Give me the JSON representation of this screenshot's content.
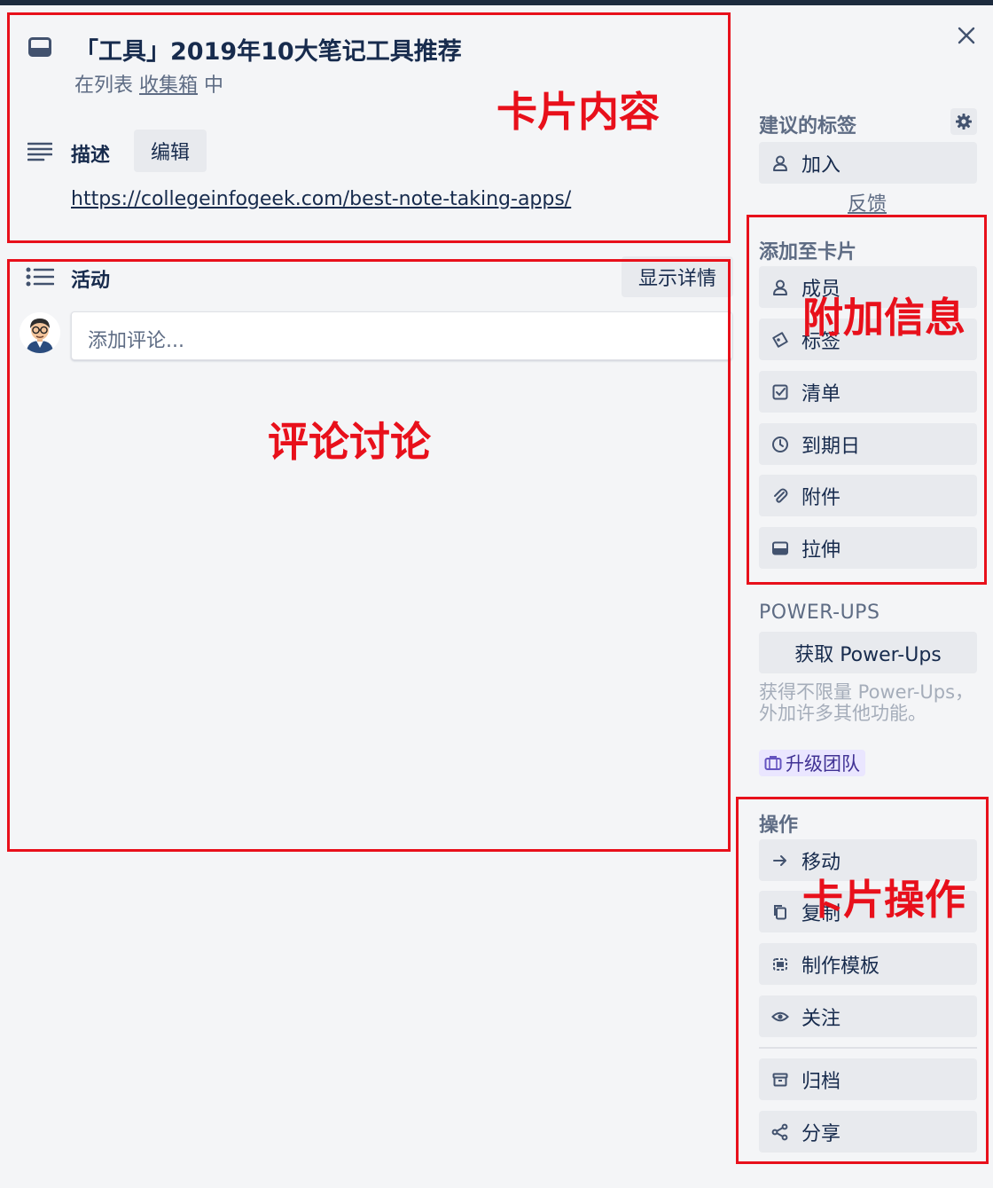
{
  "card": {
    "title": "「工具」2019年10大笔记工具推荐",
    "in_list_prefix": "在列表 ",
    "list_name": "收集箱",
    "in_list_suffix": " 中"
  },
  "description": {
    "heading": "描述",
    "edit_label": "编辑",
    "link": "https://collegeinfogeek.com/best-note-taking-apps/"
  },
  "activity": {
    "heading": "活动",
    "show_details_label": "显示详情",
    "comment_placeholder": "添加评论..."
  },
  "sidebar": {
    "suggested": {
      "heading": "建议的标签",
      "join_label": "加入",
      "feedback_label": "反馈"
    },
    "add_to_card": {
      "heading": "添加至卡片",
      "items": [
        {
          "label": "成员",
          "icon": "member-icon"
        },
        {
          "label": "标签",
          "icon": "label-icon"
        },
        {
          "label": "清单",
          "icon": "checklist-icon"
        },
        {
          "label": "到期日",
          "icon": "clock-icon"
        },
        {
          "label": "附件",
          "icon": "paperclip-icon"
        },
        {
          "label": "拉伸",
          "icon": "cover-icon"
        }
      ]
    },
    "power_ups": {
      "heading": "POWER-UPS",
      "get_label": "获取 Power-Ups",
      "description": "获得不限量 Power-Ups，外加许多其他功能。",
      "upgrade_label": "升级团队"
    },
    "actions": {
      "heading": "操作",
      "items": [
        {
          "label": "移动",
          "icon": "arrow-right-icon"
        },
        {
          "label": "复制",
          "icon": "copy-icon"
        },
        {
          "label": "制作模板",
          "icon": "template-icon"
        },
        {
          "label": "关注",
          "icon": "eye-icon"
        }
      ],
      "secondary_items": [
        {
          "label": "归档",
          "icon": "archive-icon"
        },
        {
          "label": "分享",
          "icon": "share-icon"
        }
      ]
    }
  },
  "annotations": {
    "card_content": "卡片内容",
    "comments": "评论讨论",
    "extra_info": "附加信息",
    "card_actions": "卡片操作"
  },
  "colors": {
    "annotation_red": "#e8101b",
    "background": "#f4f5f7",
    "button_bg": "#e8eaee",
    "text_primary": "#172b4d",
    "text_muted": "#5e6c84",
    "upgrade_bg": "#eae6ff"
  }
}
